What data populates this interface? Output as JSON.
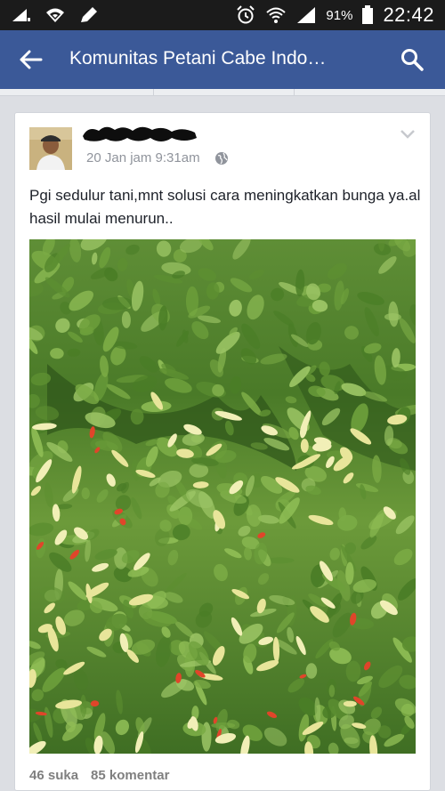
{
  "status_bar": {
    "left_icons": [
      "signal-bars-icon",
      "wifi-icon",
      "pencil-icon"
    ],
    "right_icons": [
      "alarm-icon",
      "wifi-icon",
      "cell-signal-icon",
      "battery-icon"
    ],
    "battery_percent": "91%",
    "time": "22:42"
  },
  "app_bar": {
    "title": "Komunitas Petani Cabe Indo…",
    "back_icon": "arrow-left-icon",
    "search_icon": "search-icon",
    "color": "#3b5998"
  },
  "post": {
    "author_redacted": true,
    "timestamp": "20 Jan jam 9:31am",
    "privacy_icon": "globe-icon",
    "menu_icon": "chevron-down-icon",
    "text": "Pgi sedulur tani,mnt solusi cara meningkatkan bunga ya.al hasil mulai menurun..",
    "likes": "46 suka",
    "comments": "85 komentar"
  }
}
